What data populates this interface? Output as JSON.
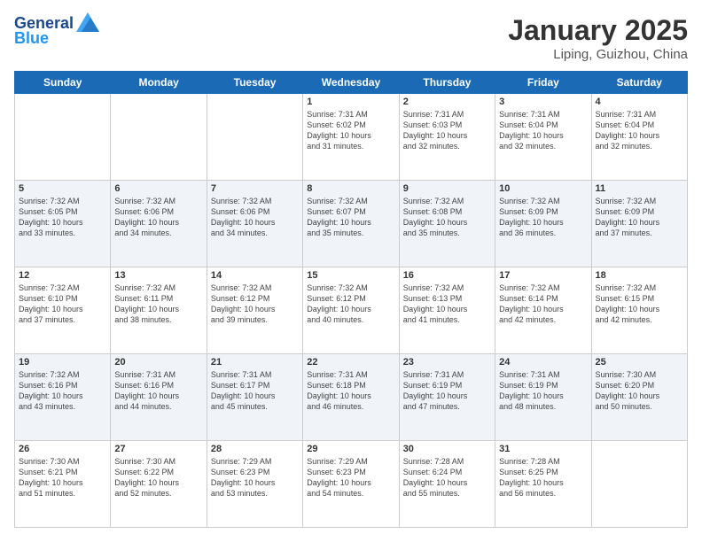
{
  "header": {
    "logo_line1": "General",
    "logo_line2": "Blue",
    "month_title": "January 2025",
    "location": "Liping, Guizhou, China"
  },
  "days_of_week": [
    "Sunday",
    "Monday",
    "Tuesday",
    "Wednesday",
    "Thursday",
    "Friday",
    "Saturday"
  ],
  "weeks": [
    [
      {
        "day": "",
        "info": ""
      },
      {
        "day": "",
        "info": ""
      },
      {
        "day": "",
        "info": ""
      },
      {
        "day": "1",
        "info": "Sunrise: 7:31 AM\nSunset: 6:02 PM\nDaylight: 10 hours\nand 31 minutes."
      },
      {
        "day": "2",
        "info": "Sunrise: 7:31 AM\nSunset: 6:03 PM\nDaylight: 10 hours\nand 32 minutes."
      },
      {
        "day": "3",
        "info": "Sunrise: 7:31 AM\nSunset: 6:04 PM\nDaylight: 10 hours\nand 32 minutes."
      },
      {
        "day": "4",
        "info": "Sunrise: 7:31 AM\nSunset: 6:04 PM\nDaylight: 10 hours\nand 32 minutes."
      }
    ],
    [
      {
        "day": "5",
        "info": "Sunrise: 7:32 AM\nSunset: 6:05 PM\nDaylight: 10 hours\nand 33 minutes."
      },
      {
        "day": "6",
        "info": "Sunrise: 7:32 AM\nSunset: 6:06 PM\nDaylight: 10 hours\nand 34 minutes."
      },
      {
        "day": "7",
        "info": "Sunrise: 7:32 AM\nSunset: 6:06 PM\nDaylight: 10 hours\nand 34 minutes."
      },
      {
        "day": "8",
        "info": "Sunrise: 7:32 AM\nSunset: 6:07 PM\nDaylight: 10 hours\nand 35 minutes."
      },
      {
        "day": "9",
        "info": "Sunrise: 7:32 AM\nSunset: 6:08 PM\nDaylight: 10 hours\nand 35 minutes."
      },
      {
        "day": "10",
        "info": "Sunrise: 7:32 AM\nSunset: 6:09 PM\nDaylight: 10 hours\nand 36 minutes."
      },
      {
        "day": "11",
        "info": "Sunrise: 7:32 AM\nSunset: 6:09 PM\nDaylight: 10 hours\nand 37 minutes."
      }
    ],
    [
      {
        "day": "12",
        "info": "Sunrise: 7:32 AM\nSunset: 6:10 PM\nDaylight: 10 hours\nand 37 minutes."
      },
      {
        "day": "13",
        "info": "Sunrise: 7:32 AM\nSunset: 6:11 PM\nDaylight: 10 hours\nand 38 minutes."
      },
      {
        "day": "14",
        "info": "Sunrise: 7:32 AM\nSunset: 6:12 PM\nDaylight: 10 hours\nand 39 minutes."
      },
      {
        "day": "15",
        "info": "Sunrise: 7:32 AM\nSunset: 6:12 PM\nDaylight: 10 hours\nand 40 minutes."
      },
      {
        "day": "16",
        "info": "Sunrise: 7:32 AM\nSunset: 6:13 PM\nDaylight: 10 hours\nand 41 minutes."
      },
      {
        "day": "17",
        "info": "Sunrise: 7:32 AM\nSunset: 6:14 PM\nDaylight: 10 hours\nand 42 minutes."
      },
      {
        "day": "18",
        "info": "Sunrise: 7:32 AM\nSunset: 6:15 PM\nDaylight: 10 hours\nand 42 minutes."
      }
    ],
    [
      {
        "day": "19",
        "info": "Sunrise: 7:32 AM\nSunset: 6:16 PM\nDaylight: 10 hours\nand 43 minutes."
      },
      {
        "day": "20",
        "info": "Sunrise: 7:31 AM\nSunset: 6:16 PM\nDaylight: 10 hours\nand 44 minutes."
      },
      {
        "day": "21",
        "info": "Sunrise: 7:31 AM\nSunset: 6:17 PM\nDaylight: 10 hours\nand 45 minutes."
      },
      {
        "day": "22",
        "info": "Sunrise: 7:31 AM\nSunset: 6:18 PM\nDaylight: 10 hours\nand 46 minutes."
      },
      {
        "day": "23",
        "info": "Sunrise: 7:31 AM\nSunset: 6:19 PM\nDaylight: 10 hours\nand 47 minutes."
      },
      {
        "day": "24",
        "info": "Sunrise: 7:31 AM\nSunset: 6:19 PM\nDaylight: 10 hours\nand 48 minutes."
      },
      {
        "day": "25",
        "info": "Sunrise: 7:30 AM\nSunset: 6:20 PM\nDaylight: 10 hours\nand 50 minutes."
      }
    ],
    [
      {
        "day": "26",
        "info": "Sunrise: 7:30 AM\nSunset: 6:21 PM\nDaylight: 10 hours\nand 51 minutes."
      },
      {
        "day": "27",
        "info": "Sunrise: 7:30 AM\nSunset: 6:22 PM\nDaylight: 10 hours\nand 52 minutes."
      },
      {
        "day": "28",
        "info": "Sunrise: 7:29 AM\nSunset: 6:23 PM\nDaylight: 10 hours\nand 53 minutes."
      },
      {
        "day": "29",
        "info": "Sunrise: 7:29 AM\nSunset: 6:23 PM\nDaylight: 10 hours\nand 54 minutes."
      },
      {
        "day": "30",
        "info": "Sunrise: 7:28 AM\nSunset: 6:24 PM\nDaylight: 10 hours\nand 55 minutes."
      },
      {
        "day": "31",
        "info": "Sunrise: 7:28 AM\nSunset: 6:25 PM\nDaylight: 10 hours\nand 56 minutes."
      },
      {
        "day": "",
        "info": ""
      }
    ]
  ]
}
